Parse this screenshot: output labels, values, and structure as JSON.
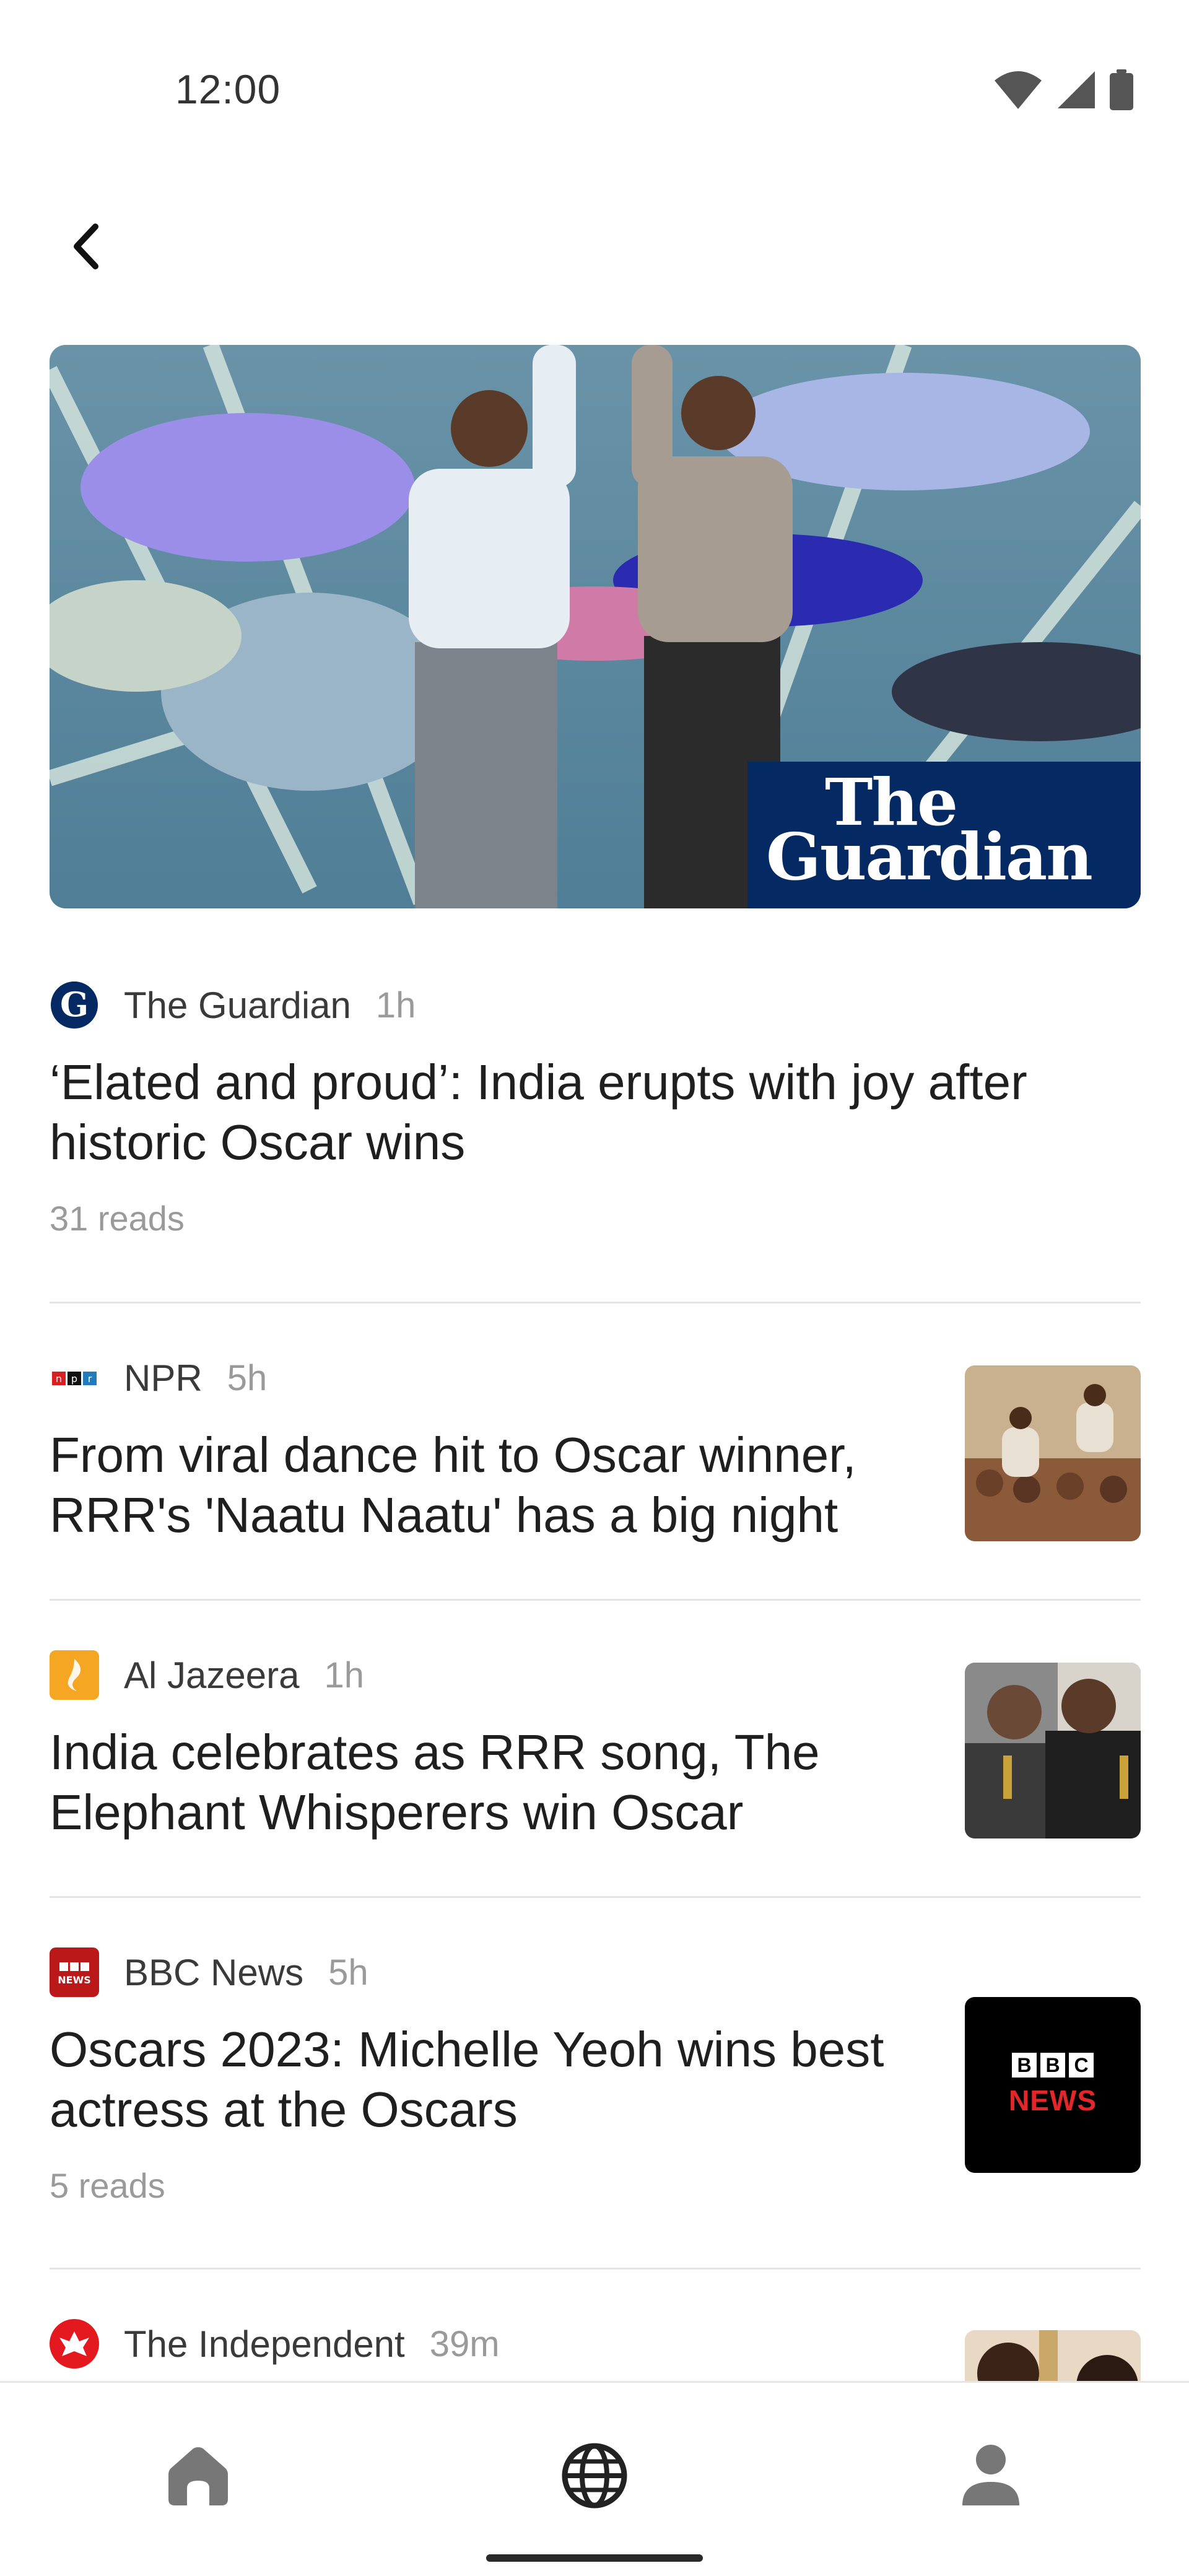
{
  "status_bar": {
    "time": "12:00",
    "icons": [
      "wifi-icon",
      "cell-signal-icon",
      "battery-icon"
    ]
  },
  "top_bar": {
    "back_icon": "back-arrow-icon"
  },
  "hero": {
    "image_description": "Oscar performance stage with dancers",
    "logo_line1": "The",
    "logo_line2": "Guardian"
  },
  "articles": [
    {
      "source": "The Guardian",
      "time": "1h",
      "headline": "‘Elated and proud’: India erupts with joy after historic Oscar wins",
      "reads": "31 reads"
    },
    {
      "source": "NPR",
      "time": "5h",
      "headline": "From viral dance hit to Oscar winner, RRR's 'Naatu Naatu' has a big night",
      "reads": ""
    },
    {
      "source": "Al Jazeera",
      "time": "1h",
      "headline": "India celebrates as RRR song, The Elephant Whisperers win Oscar",
      "reads": ""
    },
    {
      "source": "BBC News",
      "time": "5h",
      "headline": "Oscars 2023: Michelle Yeoh wins best actress at the Oscars",
      "reads": "5 reads",
      "thumb_line1": "BBC",
      "thumb_line2": "NEWS"
    },
    {
      "source": "The Independent",
      "time": "39m",
      "headline": "",
      "reads": ""
    }
  ],
  "bottom_nav": {
    "items": [
      "home-icon",
      "globe-icon",
      "profile-icon"
    ],
    "active": "globe-icon"
  },
  "colors": {
    "guardian_blue": "#052962",
    "bbc_red": "#bb1919",
    "aljazeera_orange": "#f5a623",
    "independent_red": "#e4191f"
  }
}
